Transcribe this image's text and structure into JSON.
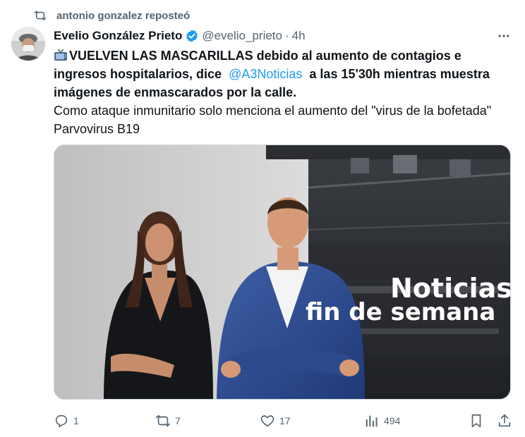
{
  "repost": {
    "icon": "repost-icon",
    "text": "antonio gonzalez reposteó"
  },
  "author": {
    "avatar": "avatar",
    "name": "Evelio González Prieto",
    "verified_icon": "verified-badge-icon",
    "handle": "@evelio_prieto",
    "separator": "·",
    "time": "4h",
    "more_icon": "more-icon"
  },
  "tweet": {
    "line1_bold_a": "VUELVEN LAS MASCARILLAS debido al aumento de contagios e ingresos hospitalarios, dice",
    "mention": "@A3Noticias",
    "line1_bold_b": "a las 15'30h mientras muestra imágenes de enmascarados por la calle.",
    "line2": "Como ataque inmunitario solo menciona el aumento del \"virus de la bofetada\" Parvovirus B19"
  },
  "media": {
    "overlay_line1": "Noticias",
    "overlay_line2": "fin de semana"
  },
  "actions": {
    "reply_count": "1",
    "repost_count": "7",
    "like_count": "17",
    "views_count": "494"
  },
  "colors": {
    "accent": "#1d9bf0",
    "secondary_text": "#536471"
  }
}
